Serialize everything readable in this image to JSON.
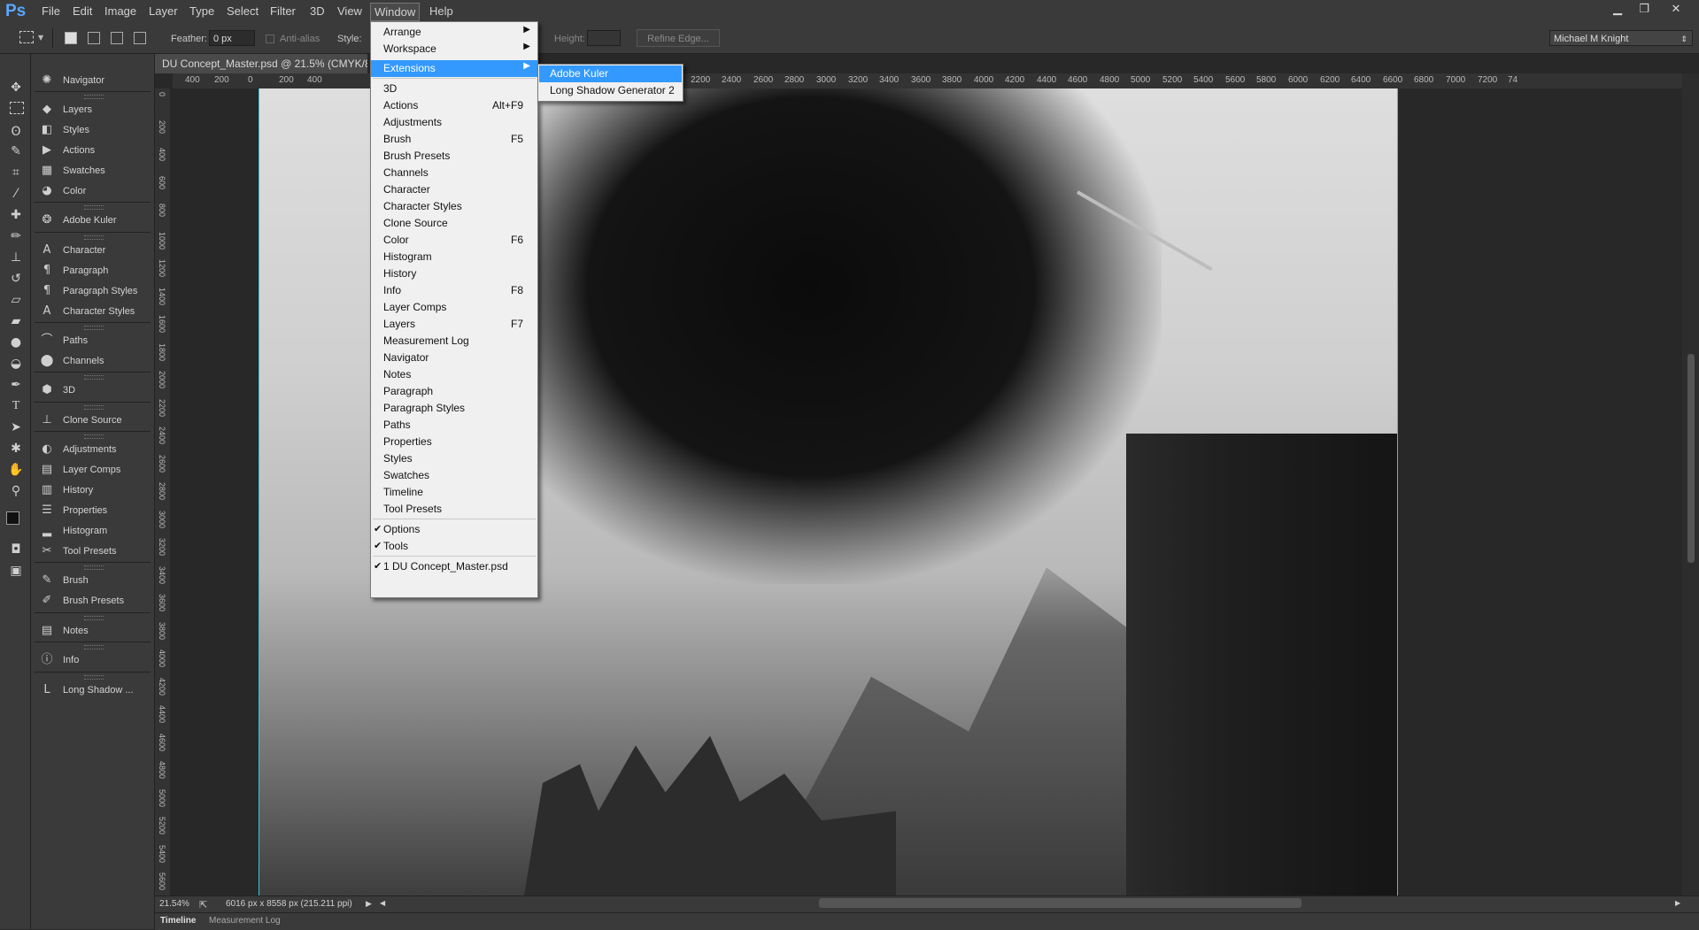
{
  "menubar": {
    "logo": "Ps",
    "items": [
      "File",
      "Edit",
      "Image",
      "Layer",
      "Type",
      "Select",
      "Filter",
      "3D",
      "View",
      "Window",
      "Help"
    ],
    "active": "Window"
  },
  "window_controls": {
    "minimize": "▁",
    "restore": "❐",
    "close": "✕"
  },
  "options": {
    "feather_label": "Feather:",
    "feather_value": "0 px",
    "antialias_label": "Anti-alias",
    "style_label": "Style:",
    "height_label": "Height:",
    "refine_edge": "Refine Edge...",
    "workspace": "Michael M Knight"
  },
  "document": {
    "tab_title": "DU Concept_Master.psd @ 21.5% (CMYK/8*)",
    "ruler_h": [
      "400",
      "200",
      "0",
      "200",
      "400",
      "2200",
      "2400",
      "2600",
      "2800",
      "3000",
      "3200",
      "3400",
      "3600",
      "3800",
      "4000",
      "4200",
      "4400",
      "4600",
      "4800",
      "5000",
      "5200",
      "5400",
      "5600",
      "5800",
      "6000",
      "6200",
      "6400",
      "6600",
      "6800",
      "7000",
      "7200",
      "74"
    ],
    "ruler_v": [
      "0",
      "200",
      "400",
      "600",
      "800",
      "1000",
      "1200",
      "1400",
      "1600",
      "1800",
      "2000",
      "2200",
      "2400",
      "2600",
      "2800",
      "3000",
      "3200",
      "3400",
      "3600",
      "3800",
      "4000",
      "4200",
      "4400",
      "4600",
      "4800",
      "5000",
      "5200",
      "5400",
      "5600"
    ]
  },
  "status": {
    "zoom": "21.54%",
    "doc_info": "6016 px x 8558 px (215.211 ppi)"
  },
  "bottom_tabs": [
    "Timeline",
    "Measurement Log"
  ],
  "panels": [
    {
      "label": "Navigator",
      "icon": "navigator-icon"
    },
    {
      "label": "Layers",
      "icon": "layers-icon"
    },
    {
      "label": "Styles",
      "icon": "styles-icon"
    },
    {
      "label": "Actions",
      "icon": "actions-icon"
    },
    {
      "label": "Swatches",
      "icon": "swatches-icon"
    },
    {
      "label": "Color",
      "icon": "color-icon"
    },
    {
      "label": "Adobe Kuler",
      "icon": "kuler-icon"
    },
    {
      "label": "Character",
      "icon": "character-icon"
    },
    {
      "label": "Paragraph",
      "icon": "paragraph-icon"
    },
    {
      "label": "Paragraph Styles",
      "icon": "paragraph-styles-icon"
    },
    {
      "label": "Character Styles",
      "icon": "character-styles-icon"
    },
    {
      "label": "Paths",
      "icon": "paths-icon"
    },
    {
      "label": "Channels",
      "icon": "channels-icon"
    },
    {
      "label": "3D",
      "icon": "3d-icon"
    },
    {
      "label": "Clone Source",
      "icon": "clone-source-icon"
    },
    {
      "label": "Adjustments",
      "icon": "adjustments-icon"
    },
    {
      "label": "Layer Comps",
      "icon": "layer-comps-icon"
    },
    {
      "label": "History",
      "icon": "history-icon"
    },
    {
      "label": "Properties",
      "icon": "properties-icon"
    },
    {
      "label": "Histogram",
      "icon": "histogram-icon"
    },
    {
      "label": "Tool Presets",
      "icon": "tool-presets-icon"
    },
    {
      "label": "Brush",
      "icon": "brush-icon"
    },
    {
      "label": "Brush Presets",
      "icon": "brush-presets-icon"
    },
    {
      "label": "Notes",
      "icon": "notes-icon"
    },
    {
      "label": "Info",
      "icon": "info-icon"
    },
    {
      "label": "Long Shadow ...",
      "icon": "long-shadow-icon"
    }
  ],
  "window_menu": {
    "items": [
      {
        "label": "Arrange",
        "submenu": true
      },
      {
        "label": "Workspace",
        "submenu": true
      },
      {
        "label": "Extensions",
        "submenu": true,
        "highlighted": true
      },
      {
        "label": "3D"
      },
      {
        "label": "Actions",
        "shortcut": "Alt+F9"
      },
      {
        "label": "Adjustments"
      },
      {
        "label": "Brush",
        "shortcut": "F5"
      },
      {
        "label": "Brush Presets"
      },
      {
        "label": "Channels"
      },
      {
        "label": "Character"
      },
      {
        "label": "Character Styles"
      },
      {
        "label": "Clone Source"
      },
      {
        "label": "Color",
        "shortcut": "F6"
      },
      {
        "label": "Histogram"
      },
      {
        "label": "History"
      },
      {
        "label": "Info",
        "shortcut": "F8"
      },
      {
        "label": "Layer Comps"
      },
      {
        "label": "Layers",
        "shortcut": "F7"
      },
      {
        "label": "Measurement Log"
      },
      {
        "label": "Navigator"
      },
      {
        "label": "Notes"
      },
      {
        "label": "Paragraph"
      },
      {
        "label": "Paragraph Styles"
      },
      {
        "label": "Paths"
      },
      {
        "label": "Properties"
      },
      {
        "label": "Styles"
      },
      {
        "label": "Swatches"
      },
      {
        "label": "Timeline"
      },
      {
        "label": "Tool Presets"
      },
      {
        "label": "Options",
        "checked": true
      },
      {
        "label": "Tools",
        "checked": true
      },
      {
        "label": "1 DU Concept_Master.psd",
        "checked": true
      }
    ],
    "extensions_submenu": [
      "Adobe Kuler",
      "Long Shadow Generator 2"
    ]
  },
  "colors": {
    "menu_highlight": "#3399ff",
    "guide": "#35c6d6",
    "ps_logo": "#5aa7ff"
  }
}
